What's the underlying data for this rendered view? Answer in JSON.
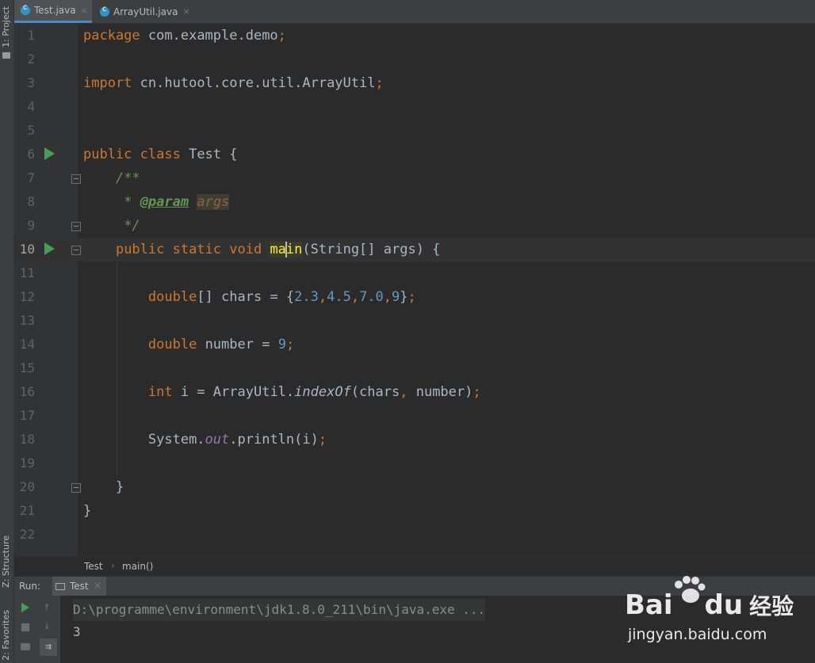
{
  "left_strip": {
    "project_label": "1: Project",
    "structure_label": "Z: Structure",
    "favorites_label": "2: Favorites"
  },
  "tabs": [
    {
      "label": "Test.java",
      "active": true
    },
    {
      "label": "ArrayUtil.java",
      "active": false
    }
  ],
  "editor": {
    "line_numbers": [
      "1",
      "2",
      "3",
      "4",
      "5",
      "6",
      "7",
      "8",
      "9",
      "10",
      "11",
      "12",
      "13",
      "14",
      "15",
      "16",
      "17",
      "18",
      "19",
      "20",
      "21",
      "22"
    ],
    "code": {
      "l1": {
        "kw": "package",
        "rest": "com.example.demo",
        "semi": ";"
      },
      "l3": {
        "kw": "import",
        "rest": "cn.hutool.core.util.ArrayUtil",
        "semi": ";"
      },
      "l6": {
        "kw": "public class",
        "rest": "Test {"
      },
      "l7": {
        "doc": "/**"
      },
      "l8": {
        "star": "*",
        "tag": "@param",
        "val": "args"
      },
      "l9": {
        "doc": "*/"
      },
      "l10": {
        "kw": "public static void",
        "name_a": "ma",
        "name_b": "in",
        "rest": "(String[] args) {"
      },
      "l12": {
        "kw": "double",
        "a": "[] chars = {",
        "n1": "2.3",
        "c1": ",",
        "n2": "4.5",
        "c2": ",",
        "n3": "7.0",
        "c3": ",",
        "n4": "9",
        "b": "}",
        "semi": ";"
      },
      "l14": {
        "kw": "double",
        "a": "number = ",
        "n": "9",
        "semi": ";"
      },
      "l16": {
        "kw": "int",
        "a": "i = ArrayUtil.",
        "m": "indexOf",
        "b": "(chars",
        "comma": ",",
        "c": " number)",
        "semi": ";"
      },
      "l18": {
        "a": "System.",
        "f": "out",
        "b": ".println(i)",
        "semi": ";"
      },
      "l20": {
        "t": "}"
      },
      "l21": {
        "t": "}"
      }
    }
  },
  "breadcrumb": {
    "class": "Test",
    "sep": "›",
    "method": "main()"
  },
  "run_panel": {
    "label": "Run:",
    "tab": "Test",
    "close": "×"
  },
  "console": {
    "command": "D:\\programme\\environment\\jdk1.8.0_211\\bin\\java.exe ...",
    "output": "3"
  },
  "watermark": {
    "brand_a": "Bai",
    "brand_b": "du",
    "brand_cn": "经验",
    "url": "jingyan.baidu.com"
  },
  "colors": {
    "keyword": "#cc7832",
    "number": "#6897bb",
    "doc": "#629755",
    "field": "#9876aa",
    "run": "#499c54",
    "text": "#a9b7c6"
  }
}
